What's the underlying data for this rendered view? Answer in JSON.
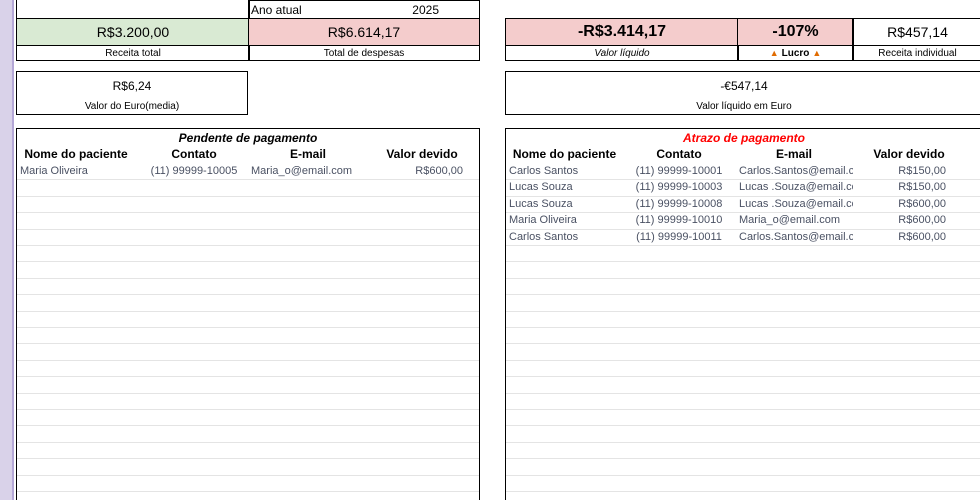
{
  "summary": {
    "current_year_label": "Ano atual",
    "current_year_value": "2025",
    "total_revenue_value": "R$3.200,00",
    "total_revenue_label": "Receita total",
    "total_expenses_value": "R$6.614,17",
    "total_expenses_label": "Total de despesas",
    "net_value_value": "-R$3.414,17",
    "net_value_label": "Valor líquido",
    "profit_pct_value": "-107%",
    "profit_pct_label": "Lucro",
    "individual_revenue_value": "R$457,14",
    "individual_revenue_label": "Receita individual",
    "euro_avg_value": "R$6,24",
    "euro_avg_label": "Valor do Euro(media)",
    "net_euro_value": "-€547,14",
    "net_euro_label": "Valor líquido em Euro"
  },
  "pending": {
    "title": "Pendente de pagamento",
    "headers": [
      "Nome do paciente",
      "Contato",
      "E-mail",
      "Valor devido"
    ],
    "rows": [
      [
        "Maria Oliveira",
        "(11) 99999-10005",
        "Maria_o@email.com",
        "R$600,00"
      ]
    ]
  },
  "overdue": {
    "title": "Atrazo de pagamento",
    "title_color": "#ff0000",
    "headers": [
      "Nome do paciente",
      "Contato",
      "E-mail",
      "Valor devido"
    ],
    "rows": [
      [
        "Carlos Santos",
        "(11) 99999-10001",
        "Carlos.Santos@email.cc",
        "R$150,00"
      ],
      [
        "Lucas Souza",
        "(11) 99999-10003",
        "Lucas .Souza@email.cor",
        "R$150,00"
      ],
      [
        "Lucas Souza",
        "(11) 99999-10008",
        "Lucas .Souza@email.cor",
        "R$600,00"
      ],
      [
        "Maria Oliveira",
        "(11) 99999-10010",
        "Maria_o@email.com",
        "R$600,00"
      ],
      [
        "Carlos Santos",
        "(11) 99999-10011",
        "Carlos.Santos@email.cc",
        "R$600,00"
      ]
    ]
  },
  "colors": {
    "revenue_bg": "#d9ead3",
    "expense_bg": "#f4cccc",
    "frame": "#b4a7d6"
  },
  "icons": {
    "profit_icon": "fire-icon"
  }
}
